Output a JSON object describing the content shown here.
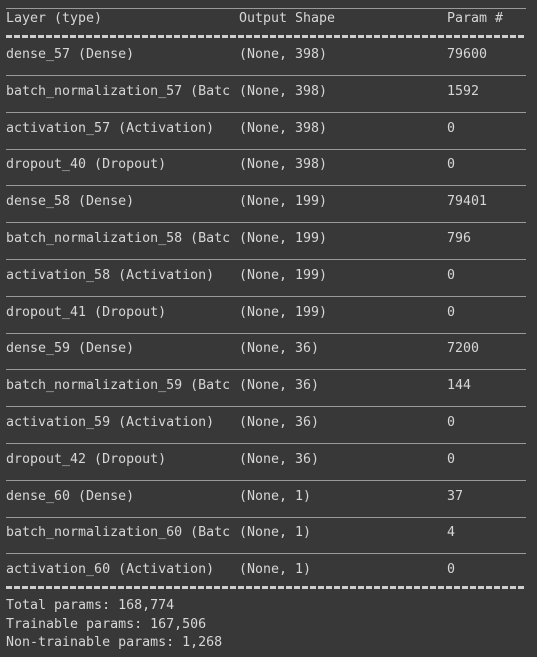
{
  "header": {
    "layer": "Layer (type)",
    "shape": "Output Shape",
    "param": "Param #"
  },
  "rows": [
    {
      "layer": "dense_57 (Dense)",
      "shape": "(None, 398)",
      "param": "79600"
    },
    {
      "layer": "batch_normalization_57 (Batc",
      "shape": "(None, 398)",
      "param": "1592"
    },
    {
      "layer": "activation_57 (Activation)",
      "shape": "(None, 398)",
      "param": "0"
    },
    {
      "layer": "dropout_40 (Dropout)",
      "shape": "(None, 398)",
      "param": "0"
    },
    {
      "layer": "dense_58 (Dense)",
      "shape": "(None, 199)",
      "param": "79401"
    },
    {
      "layer": "batch_normalization_58 (Batc",
      "shape": "(None, 199)",
      "param": "796"
    },
    {
      "layer": "activation_58 (Activation)",
      "shape": "(None, 199)",
      "param": "0"
    },
    {
      "layer": "dropout_41 (Dropout)",
      "shape": "(None, 199)",
      "param": "0"
    },
    {
      "layer": "dense_59 (Dense)",
      "shape": "(None, 36)",
      "param": "7200"
    },
    {
      "layer": "batch_normalization_59 (Batc",
      "shape": "(None, 36)",
      "param": "144"
    },
    {
      "layer": "activation_59 (Activation)",
      "shape": "(None, 36)",
      "param": "0"
    },
    {
      "layer": "dropout_42 (Dropout)",
      "shape": "(None, 36)",
      "param": "0"
    },
    {
      "layer": "dense_60 (Dense)",
      "shape": "(None, 1)",
      "param": "37"
    },
    {
      "layer": "batch_normalization_60 (Batc",
      "shape": "(None, 1)",
      "param": "4"
    },
    {
      "layer": "activation_60 (Activation)",
      "shape": "(None, 1)",
      "param": "0"
    }
  ],
  "footer": {
    "total": "Total params: 168,774",
    "trainable": "Trainable params: 167,506",
    "non_trainable": "Non-trainable params: 1,268"
  },
  "colors": {
    "background": "#383838",
    "text": "#d6d6d6",
    "separator": "#9a9a9a"
  }
}
